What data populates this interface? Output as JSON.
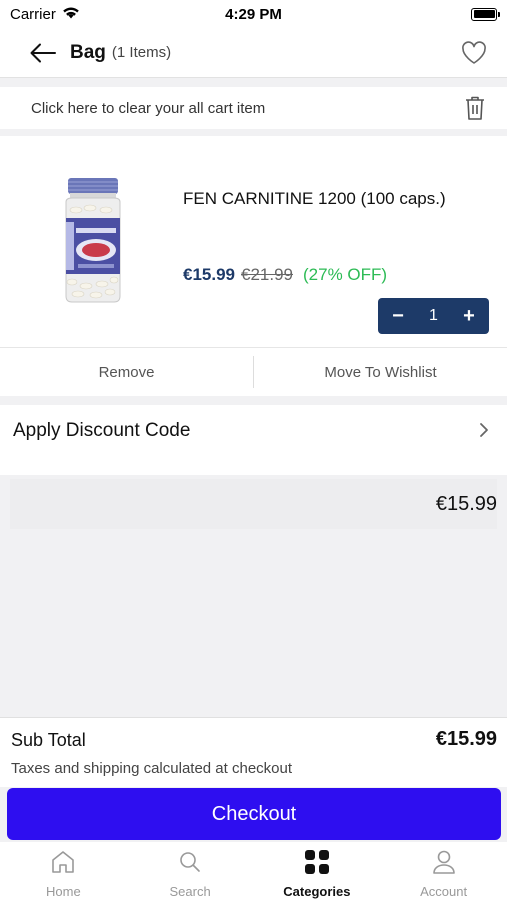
{
  "status": {
    "carrier": "Carrier",
    "time": "4:29 PM"
  },
  "header": {
    "title": "Bag",
    "count": "(1 Items)"
  },
  "clear_cart": {
    "text": "Click here to clear your all cart item"
  },
  "item": {
    "name": "FEN CARNITINE 1200 (100 caps.)",
    "price": "€15.99",
    "old_price": "€21.99",
    "discount": "(27% OFF)",
    "quantity": "1",
    "minus": "−",
    "plus": "+",
    "remove_label": "Remove",
    "wishlist_label": "Move To Wishlist"
  },
  "discount_code": {
    "label": "Apply Discount Code"
  },
  "items_total": "€15.99",
  "summary": {
    "subtotal_label": "Sub Total",
    "subtotal_value": "€15.99",
    "note": "Taxes and shipping calculated at checkout"
  },
  "checkout": {
    "label": "Checkout"
  },
  "tabs": [
    {
      "label": "Home",
      "icon": "home-icon"
    },
    {
      "label": "Search",
      "icon": "search-icon"
    },
    {
      "label": "Categories",
      "icon": "grid-icon"
    },
    {
      "label": "Account",
      "icon": "user-icon"
    }
  ],
  "colors": {
    "accent": "#2e0ef0",
    "stepper": "#1d3a68",
    "price": "#1d3a68",
    "discount": "#2dbb55"
  }
}
